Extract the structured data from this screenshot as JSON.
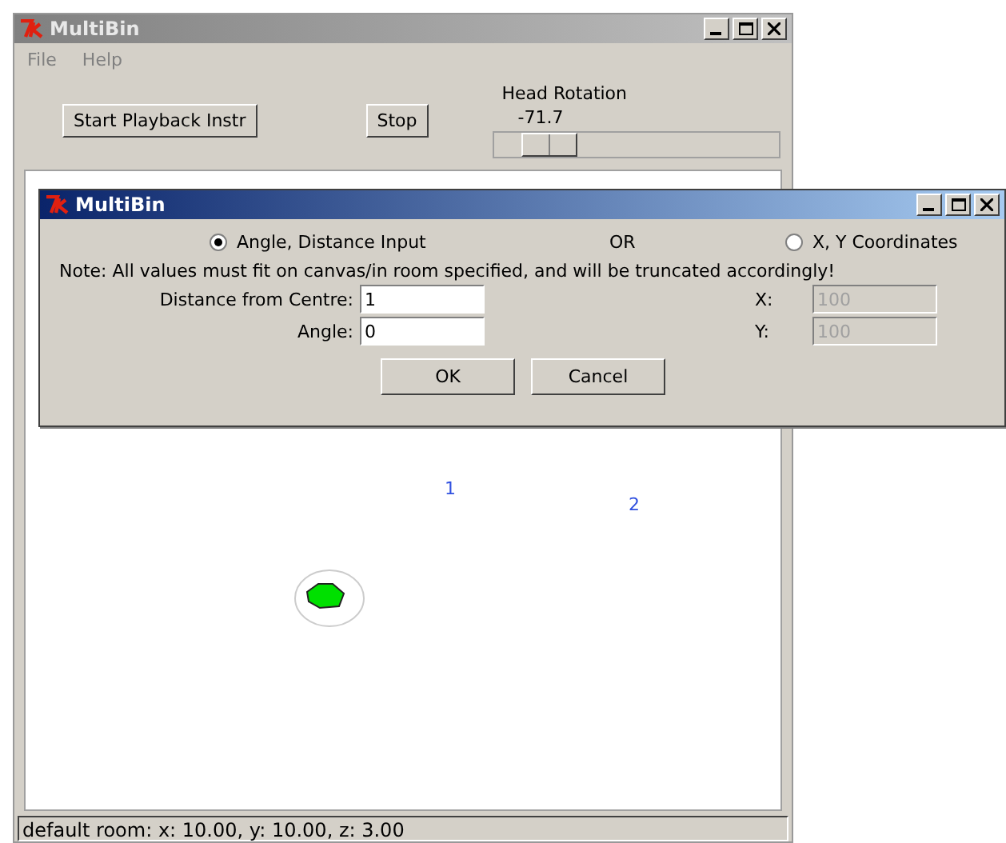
{
  "main_window": {
    "title": "MultiBin",
    "menu": [
      {
        "label": "File"
      },
      {
        "label": "Help"
      }
    ],
    "toolbar": {
      "buttons": [
        "Start Playback Instr",
        "Stop"
      ],
      "head_rotation": {
        "label": "Head Rotation",
        "reading": "-71.7",
        "level": 0.12
      }
    },
    "canvas": {
      "labels": [
        {
          "text": "1"
        },
        {
          "text": "2"
        }
      ]
    },
    "status_bar": "default room: x: 10.00, y: 10.00, z: 3.00"
  },
  "dialog": {
    "title": "MultiBin",
    "modes": [
      {
        "label": "Angle, Distance Input",
        "selected": true
      },
      {
        "label": "X, Y Coordinates",
        "selected": false
      }
    ],
    "separator": "OR",
    "note": "Note: All values must fit on canvas/in room specified, and will be truncated accordingly!",
    "fields": [
      {
        "label": "Distance from Centre:",
        "value": "1",
        "disabled": false
      },
      {
        "label": "Angle:",
        "value": "0",
        "disabled": false
      },
      {
        "label": "X:",
        "value": "100",
        "disabled": true
      },
      {
        "label": "Y:",
        "value": "100",
        "disabled": true
      }
    ],
    "buttons": [
      "OK",
      "Cancel"
    ]
  }
}
